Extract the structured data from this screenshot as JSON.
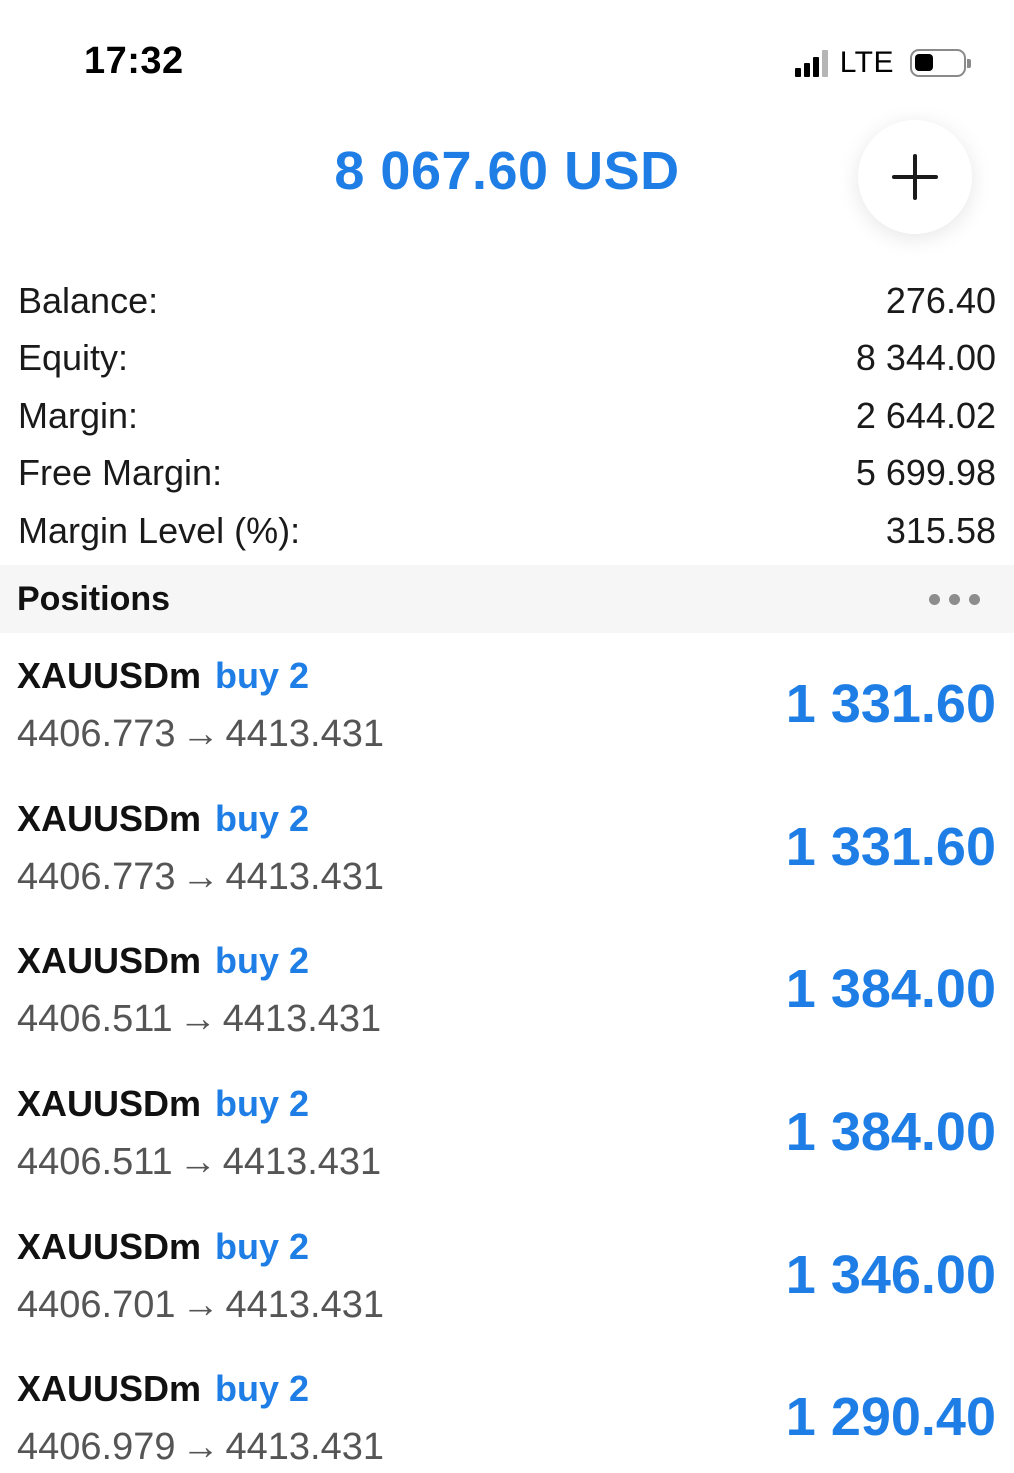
{
  "status_bar": {
    "time": "17:32",
    "network": "LTE"
  },
  "header": {
    "equity_title": "8 067.60 USD",
    "add_icon": "plus-icon"
  },
  "summary": [
    {
      "label": "Balance:",
      "value": "276.40"
    },
    {
      "label": "Equity:",
      "value": "8 344.00"
    },
    {
      "label": "Margin:",
      "value": "2 644.02"
    },
    {
      "label": "Free Margin:",
      "value": "5 699.98"
    },
    {
      "label": "Margin Level (%):",
      "value": "315.58"
    }
  ],
  "positions": {
    "title": "Positions",
    "more_icon": "more-icon",
    "items": [
      {
        "symbol": "XAUUSDm",
        "side": "buy 2",
        "open": "4406.773",
        "arrow": "→",
        "current": "4413.431",
        "profit": "1 331.60"
      },
      {
        "symbol": "XAUUSDm",
        "side": "buy 2",
        "open": "4406.773",
        "arrow": "→",
        "current": "4413.431",
        "profit": "1 331.60"
      },
      {
        "symbol": "XAUUSDm",
        "side": "buy 2",
        "open": "4406.511",
        "arrow": "→",
        "current": "4413.431",
        "profit": "1 384.00"
      },
      {
        "symbol": "XAUUSDm",
        "side": "buy 2",
        "open": "4406.511",
        "arrow": "→",
        "current": "4413.431",
        "profit": "1 384.00"
      },
      {
        "symbol": "XAUUSDm",
        "side": "buy 2",
        "open": "4406.701",
        "arrow": "→",
        "current": "4413.431",
        "profit": "1 346.00"
      },
      {
        "symbol": "XAUUSDm",
        "side": "buy 2",
        "open": "4406.979",
        "arrow": "→",
        "current": "4413.431",
        "profit": "1 290.40"
      }
    ]
  },
  "colors": {
    "accent": "#1e7ee6",
    "section_bg": "#f6f6f6",
    "secondary_text": "#555555"
  }
}
